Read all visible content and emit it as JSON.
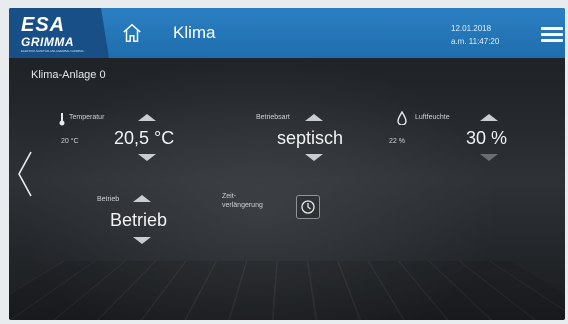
{
  "header": {
    "logo_main": "ESA",
    "logo_sub": "GRIMMA",
    "logo_tagline": "ELEKTRO-SANITÄR-ANLAGENBAU GRIMMA",
    "title": "Klima",
    "date": "12.01.2018",
    "time": "a.m. 11:47:20",
    "icons": [
      "home-icon",
      "menu-icon"
    ]
  },
  "panel": {
    "title": "Klima-Anlage 0",
    "temperature": {
      "label": "Temperatur",
      "current": "20 °C",
      "setpoint": "20,5 °C",
      "icon": "thermometer-icon"
    },
    "mode": {
      "label": "Betriebsart",
      "value": "septisch"
    },
    "humidity": {
      "label": "Luftfeuchte",
      "current": "22 %",
      "setpoint": "30 %",
      "icon": "droplet-icon"
    },
    "operation": {
      "label": "Betrieb",
      "value": "Betrieb"
    },
    "extension": {
      "label_line1": "Zeit-",
      "label_line2": "verlängerung",
      "icon": "timer-icon"
    }
  },
  "colors": {
    "header": "#2278bb",
    "logo_bg": "#174f86",
    "text": "#e8eaec"
  }
}
